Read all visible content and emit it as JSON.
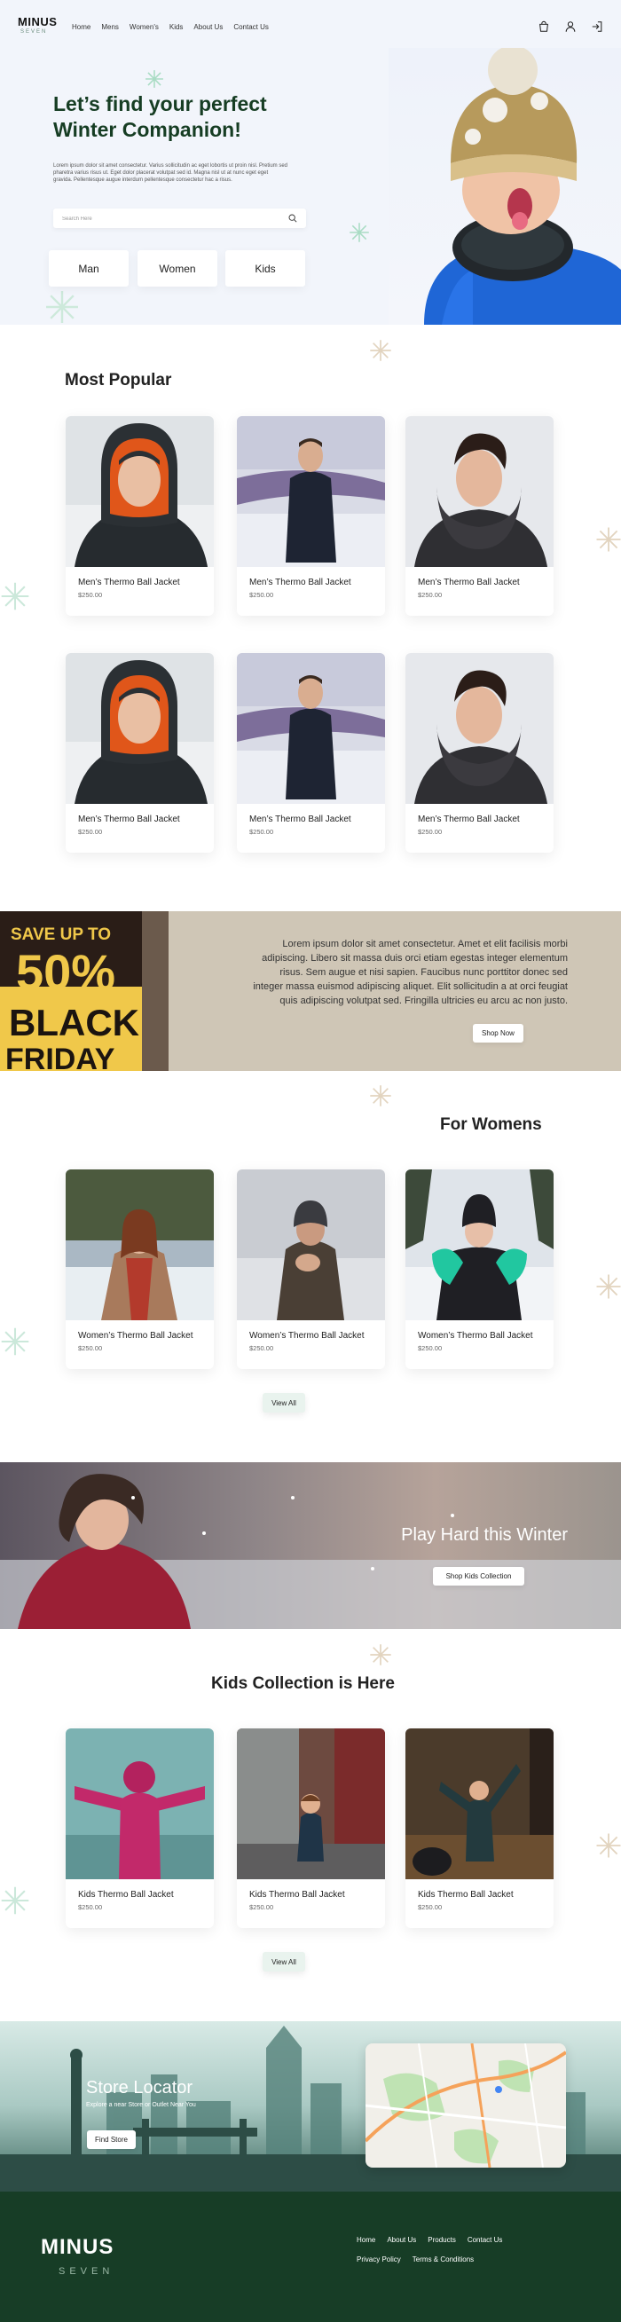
{
  "brand": {
    "name": "MINUS",
    "tagline": "SEVEN"
  },
  "nav": {
    "items": [
      "Home",
      "Mens",
      "Women's",
      "Kids",
      "About Us",
      "Contact Us"
    ]
  },
  "header_icons": [
    "shopping-bag-icon",
    "user-icon",
    "sign-in-icon"
  ],
  "hero": {
    "title_line1": "Let’s find your perfect",
    "title_line2": "Winter Companion!",
    "subtitle": "Lorem ipsum dolor sit amet consectetur. Varius sollicitudin ac eget lobortis ut proin nisl. Pretium sed pharetra varius risus ut. Eget dolor placerat volutpat sed id. Magna nisl ut at nunc eget eget gravida. Pellentesque augue interdum pellentesque consectetur hac a risus.",
    "search_placeholder": "Search Here",
    "categories": [
      "Man",
      "Women",
      "Kids"
    ]
  },
  "most_popular": {
    "title": "Most Popular",
    "products": [
      {
        "name": "Men’s Thermo Ball Jacket",
        "price": "$250.00"
      },
      {
        "name": "Men’s Thermo Ball Jacket",
        "price": "$250.00"
      },
      {
        "name": "Men’s Thermo Ball Jacket",
        "price": "$250.00"
      },
      {
        "name": "Men’s Thermo Ball Jacket",
        "price": "$250.00"
      },
      {
        "name": "Men’s Thermo Ball Jacket",
        "price": "$250.00"
      },
      {
        "name": "Men’s Thermo Ball Jacket",
        "price": "$250.00"
      }
    ]
  },
  "black_friday": {
    "sign_line1": "SAVE UP TO",
    "sign_line2": "50%",
    "sign_line3": "BLACK",
    "sign_line4": "FRIDAY",
    "text": "Lorem ipsum dolor sit amet consectetur. Amet et elit facilisis morbi adipiscing. Libero sit massa duis orci etiam egestas integer elementum risus. Sem augue et nisi sapien. Faucibus nunc porttitor donec sed integer massa euismod adipiscing aliquet. Elit sollicitudin a at orci feugiat quis adipiscing volutpat sed. Fringilla ultricies eu arcu ac non justo.",
    "button": "Shop Now"
  },
  "womens": {
    "title": "For Womens",
    "products": [
      {
        "name": "Women’s Thermo Ball Jacket",
        "price": "$250.00"
      },
      {
        "name": "Women’s Thermo Ball Jacket",
        "price": "$250.00"
      },
      {
        "name": "Women’s Thermo Ball Jacket",
        "price": "$250.00"
      }
    ],
    "view_all": "View All"
  },
  "winter_banner": {
    "title": "Play Hard this Winter",
    "button": "Shop Kids Collection"
  },
  "kids": {
    "title": "Kids Collection is Here",
    "products": [
      {
        "name": "Kids Thermo Ball Jacket",
        "price": "$250.00"
      },
      {
        "name": "Kids Thermo Ball Jacket",
        "price": "$250.00"
      },
      {
        "name": "Kids Thermo Ball Jacket",
        "price": "$250.00"
      }
    ],
    "view_all": "View All"
  },
  "store_locator": {
    "title": "Store Locator",
    "subtitle": "Explore a near Store or Outlet Near You",
    "button": "Find Store"
  },
  "footer": {
    "logo_line1": "MINUS",
    "logo_line2": "SEVEN",
    "links_row1": [
      "Home",
      "About Us",
      "Products",
      "Contact Us"
    ],
    "links_row2": [
      "Privacy Policy",
      "Terms  & Conditions"
    ]
  },
  "colors": {
    "brand_green": "#173d26",
    "hero_bg": "#f2f5fb",
    "accent_tan": "#cfc6b6"
  }
}
